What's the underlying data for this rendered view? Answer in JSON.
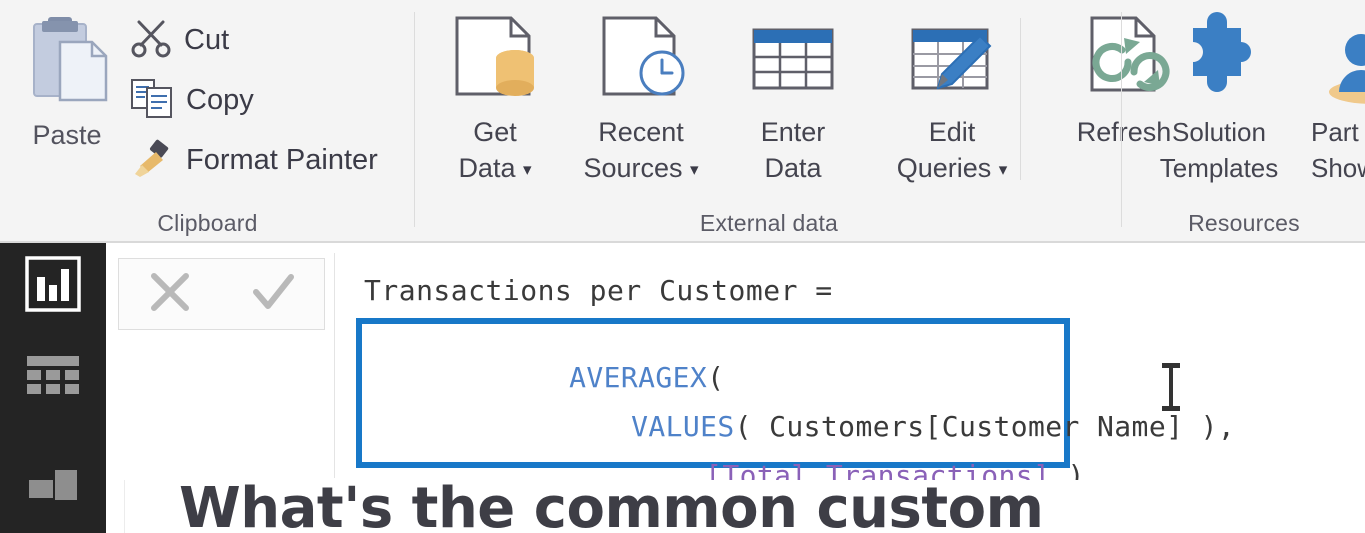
{
  "ribbon": {
    "groups": [
      {
        "name": "Clipboard",
        "title": "Clipboard",
        "paste": {
          "label": "Paste",
          "icon": "clipboard-paste-icon"
        },
        "items": [
          {
            "label": "Cut",
            "icon": "scissors-icon"
          },
          {
            "label": "Copy",
            "icon": "copy-pages-icon"
          },
          {
            "label": "Format Painter",
            "icon": "paint-brush-icon"
          }
        ]
      },
      {
        "name": "External data",
        "title": "External data",
        "buttons": [
          {
            "line1": "Get",
            "line2": "Data",
            "caret": "▾",
            "icon": "get-data-icon"
          },
          {
            "line1": "Recent",
            "line2": "Sources",
            "caret": "▾",
            "icon": "recent-sources-icon"
          },
          {
            "line1": "Enter",
            "line2": "Data",
            "caret": "",
            "icon": "enter-data-table-icon"
          },
          {
            "line1": "Edit",
            "line2": "Queries",
            "caret": "▾",
            "icon": "edit-queries-icon"
          },
          {
            "line1": "Refresh",
            "line2": "",
            "caret": "",
            "icon": "refresh-icon"
          }
        ]
      },
      {
        "name": "Resources",
        "title": "Resources",
        "buttons": [
          {
            "line1": "Solution",
            "line2": "Templates",
            "icon": "puzzle-piece-icon"
          },
          {
            "line1": "Part",
            "line2": "Show",
            "icon": "people-partner-icon"
          }
        ]
      }
    ]
  },
  "navrail": {
    "items": [
      {
        "name": "report-view",
        "icon": "bar-chart-icon",
        "selected": true
      },
      {
        "name": "data-view",
        "icon": "table-grid-icon",
        "selected": false
      },
      {
        "name": "model-view",
        "icon": "model-relationships-icon",
        "selected": false
      }
    ]
  },
  "formula_bar": {
    "cancel_icon": "cancel-x-icon",
    "commit_icon": "commit-check-icon",
    "measure_title": "Transactions per Customer =",
    "highlight_color": "#1878c8",
    "code_lines": [
      {
        "tokens": [
          {
            "text": "AVERAGEX",
            "type": "function",
            "color": "#4f82c9"
          },
          {
            "text": "(",
            "type": "plain",
            "color": "#3a3a3a"
          }
        ]
      },
      {
        "tokens": [
          {
            "text": "VALUES",
            "type": "function",
            "color": "#4f82c9"
          },
          {
            "text": "( Customers[Customer Name] ),",
            "type": "plain",
            "color": "#3a3a3a"
          }
        ]
      },
      {
        "tokens": [
          {
            "text": "[Total Transactions]",
            "type": "measure",
            "color": "#8a61b8"
          },
          {
            "text": " )",
            "type": "plain",
            "color": "#3a3a3a"
          }
        ]
      }
    ]
  },
  "canvas": {
    "headline": "What's the common custom"
  },
  "cursor": {
    "icon": "i-beam-text-cursor"
  }
}
